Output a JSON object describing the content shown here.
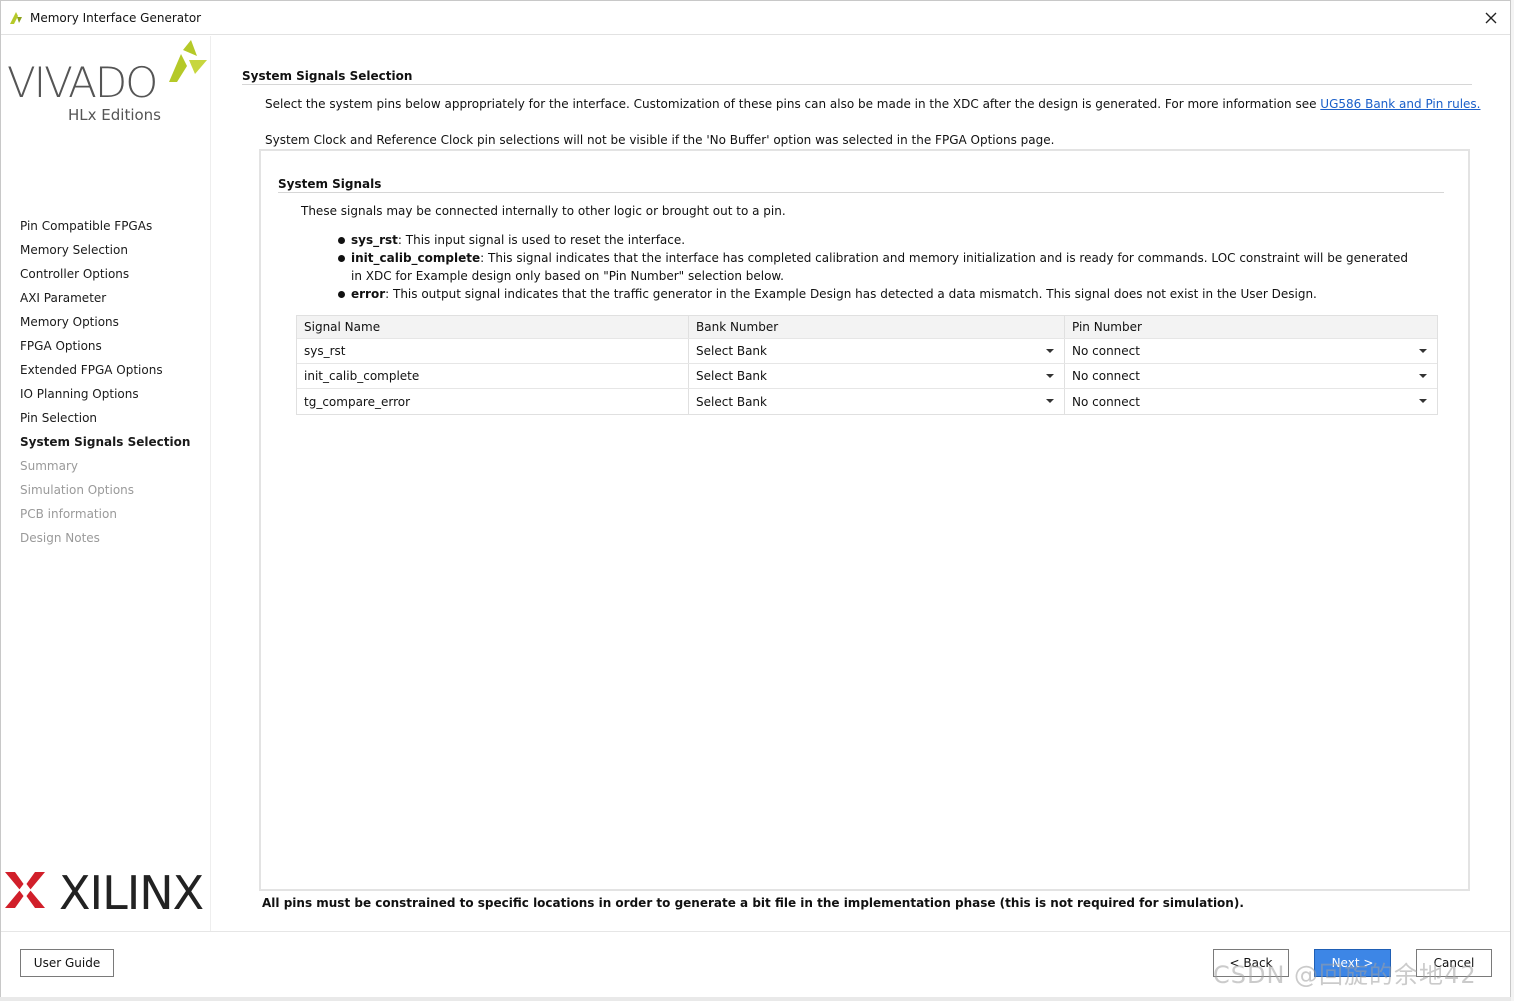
{
  "window": {
    "title": "Memory Interface Generator"
  },
  "branding": {
    "vivado": "VIVADO",
    "hlx": "HLx Editions",
    "xilinx": "XILINX",
    "vivado_accent": "#b5c928",
    "xilinx_accent": "#d11f2a"
  },
  "sidebar": {
    "items": [
      {
        "label": "Pin Compatible FPGAs",
        "state": "done"
      },
      {
        "label": "Memory Selection",
        "state": "done"
      },
      {
        "label": "Controller Options",
        "state": "done"
      },
      {
        "label": "AXI Parameter",
        "state": "done"
      },
      {
        "label": "Memory Options",
        "state": "done"
      },
      {
        "label": "FPGA Options",
        "state": "done"
      },
      {
        "label": "Extended FPGA Options",
        "state": "done"
      },
      {
        "label": "IO Planning Options",
        "state": "done"
      },
      {
        "label": "Pin Selection",
        "state": "done"
      },
      {
        "label": "System Signals Selection",
        "state": "current"
      },
      {
        "label": "Summary",
        "state": "disabled"
      },
      {
        "label": "Simulation Options",
        "state": "disabled"
      },
      {
        "label": "PCB information",
        "state": "disabled"
      },
      {
        "label": "Design Notes",
        "state": "disabled"
      }
    ]
  },
  "main": {
    "title": "System Signals Selection",
    "intro_text": "Select the system pins below appropriately for the interface. Customization of these pins can also be made in the XDC after the design is generated. For more information see ",
    "intro_link": "UG586 Bank and Pin rules.",
    "intro_text2": "System Clock and Reference Clock pin selections will not be visible if the 'No Buffer' option was selected in the FPGA Options page.",
    "panel": {
      "title": "System Signals",
      "description": "These signals may be connected internally to other logic or brought out to a pin.",
      "bullets": [
        {
          "name": "sys_rst",
          "text": ": This input signal is used to reset the interface."
        },
        {
          "name": "init_calib_complete",
          "text": ": This signal indicates that the interface has completed calibration and memory initialization and is ready for commands. LOC constraint will be generated in XDC for Example design only based on \"Pin Number\" selection below."
        },
        {
          "name": "error",
          "text": ": This output signal indicates that the traffic generator in the Example Design has detected a data mismatch. This signal does not exist in the User Design."
        }
      ],
      "table": {
        "headers": [
          "Signal Name",
          "Bank Number",
          "Pin Number"
        ],
        "rows": [
          {
            "signal": "sys_rst",
            "bank": "Select Bank",
            "pin": "No connect"
          },
          {
            "signal": "init_calib_complete",
            "bank": "Select Bank",
            "pin": "No connect"
          },
          {
            "signal": "tg_compare_error",
            "bank": "Select Bank",
            "pin": "No connect"
          }
        ]
      }
    },
    "footnote": "All pins must be constrained to specific locations in order to generate a bit file in the implementation phase (this is not required for simulation)."
  },
  "buttons": {
    "user_guide": "User Guide",
    "back": "< Back",
    "next": "Next >",
    "cancel": "Cancel"
  },
  "watermark": "CSDN @回旋的余地42"
}
